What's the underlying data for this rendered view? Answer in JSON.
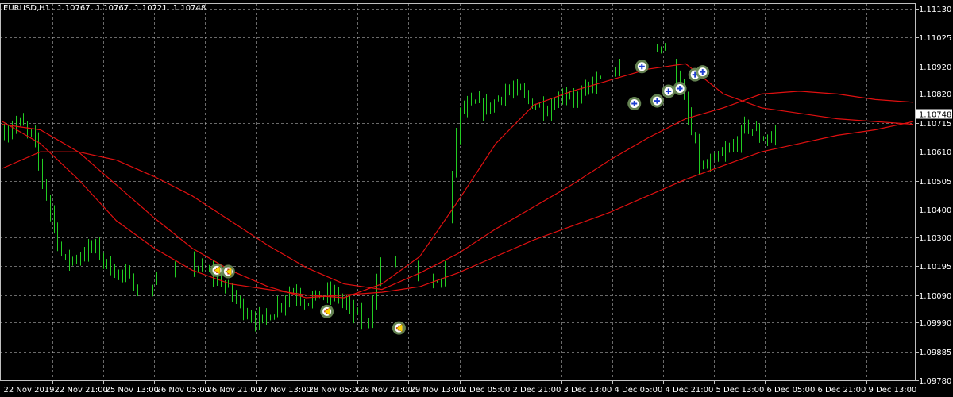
{
  "header": {
    "symbol": "EURUSD,H1",
    "open": "1.10767",
    "high": "1.10767",
    "low": "1.10721",
    "close": "1.10748"
  },
  "colors": {
    "background": "#000000",
    "grid": "#c0c0c0",
    "candles": "#22cc22",
    "ma": "#e01010",
    "current_price_line": "#9aa0a8",
    "arrow_buy": "#1f3fd0",
    "arrow_close": "#e03020",
    "circle": "#6e8f5a",
    "triangle": "#ffd400"
  },
  "current_price_label": "1.10748",
  "chart_data": {
    "type": "line",
    "title": "EURUSD,H1",
    "x_axis_type": "datetime",
    "x_ticks": [
      "22 Nov 2019",
      "22 Nov 21:00",
      "25 Nov 13:00",
      "26 Nov 05:00",
      "26 Nov 21:00",
      "27 Nov 13:00",
      "28 Nov 05:00",
      "28 Nov 21:00",
      "29 Nov 13:00",
      "2 Dec 05:00",
      "2 Dec 21:00",
      "3 Dec 13:00",
      "4 Dec 05:00",
      "4 Dec 21:00",
      "5 Dec 13:00",
      "6 Dec 05:00",
      "6 Dec 21:00",
      "9 Dec 13:00"
    ],
    "y_ticks": [
      1.1113,
      1.11025,
      1.1092,
      1.1082,
      1.10715,
      1.1061,
      1.10505,
      1.104,
      1.103,
      1.10195,
      1.1009,
      1.0999,
      1.09885,
      1.0978
    ],
    "ylim": [
      1.0978,
      1.1115
    ],
    "grid": true,
    "current_price": 1.10748,
    "close_series": {
      "name": "EURUSD close",
      "x": [
        0,
        4,
        8,
        12,
        16,
        20,
        24,
        28,
        32,
        36,
        40,
        44,
        48,
        52,
        56,
        60,
        64,
        68,
        72,
        76,
        80,
        84,
        88,
        92,
        96,
        100,
        104,
        108,
        112,
        116,
        120,
        124,
        128,
        132,
        136,
        140,
        144,
        148,
        152,
        156,
        160,
        164,
        168,
        172,
        176,
        180,
        184,
        188,
        192,
        196,
        200,
        204,
        208,
        212,
        216,
        220,
        224,
        228,
        232,
        236,
        240
      ],
      "values": [
        1.1068,
        1.1072,
        1.1066,
        1.1042,
        1.1021,
        1.1023,
        1.1027,
        1.1019,
        1.1016,
        1.1011,
        1.1013,
        1.1017,
        1.1021,
        1.1019,
        1.1016,
        1.101,
        1.1003,
        1.0999,
        1.1004,
        1.1011,
        1.1007,
        1.1009,
        1.1009,
        1.1003,
        1.0998,
        1.1023,
        1.102,
        1.1018,
        1.1012,
        1.1014,
        1.1075,
        1.1078,
        1.1077,
        1.1083,
        1.1083,
        1.1078,
        1.1077,
        1.1083,
        1.108,
        1.1087,
        1.1087,
        1.1095,
        1.1099,
        1.1101,
        1.1097,
        1.1076,
        1.1054,
        1.1058,
        1.1062,
        1.1071,
        1.1066,
        1.1067
      ]
    },
    "series": [
      {
        "name": "",
        "x": [
          0,
          10,
          20,
          30,
          40,
          50,
          60,
          70,
          80,
          90,
          100,
          110,
          120,
          130,
          140,
          150,
          160,
          170,
          180,
          190,
          200,
          210,
          220,
          230,
          240
        ],
        "values": [
          1.1072,
          1.1064,
          1.1051,
          1.1036,
          1.1026,
          1.1018,
          1.1013,
          1.1011,
          1.1009,
          1.1008,
          1.1013,
          1.1023,
          1.1043,
          1.1064,
          1.1078,
          1.1083,
          1.1087,
          1.1091,
          1.1093,
          1.1082,
          1.1077,
          1.1075,
          1.1073,
          1.1072,
          1.1071
        ]
      },
      {
        "name": "",
        "x": [
          0,
          10,
          20,
          30,
          40,
          50,
          60,
          70,
          80,
          90,
          100,
          110,
          120,
          130,
          140,
          150,
          160,
          170,
          180,
          190,
          200,
          210,
          220,
          230,
          240
        ],
        "values": [
          1.1055,
          1.1061,
          1.1061,
          1.1058,
          1.1052,
          1.1045,
          1.1036,
          1.1027,
          1.1019,
          1.1013,
          1.1011,
          1.1017,
          1.1024,
          1.1033,
          1.1041,
          1.1049,
          1.1058,
          1.1066,
          1.1073,
          1.1077,
          1.1082,
          1.1083,
          1.1082,
          1.108,
          1.1079
        ]
      },
      {
        "name": "",
        "x": [
          0,
          10,
          20,
          30,
          40,
          50,
          60,
          70,
          80,
          90,
          100,
          110,
          120,
          130,
          140,
          150,
          160,
          170,
          180,
          190,
          200,
          210,
          220,
          230,
          240
        ],
        "values": [
          1.1071,
          1.1069,
          1.1061,
          1.1049,
          1.1037,
          1.1026,
          1.1018,
          1.1012,
          1.1008,
          1.1009,
          1.101,
          1.1012,
          1.1017,
          1.1023,
          1.1029,
          1.1034,
          1.1039,
          1.1045,
          1.1051,
          1.1056,
          1.1061,
          1.1064,
          1.1067,
          1.1069,
          1.1072
        ]
      }
    ],
    "markers": [
      {
        "kind": "close",
        "x": 56.5,
        "y": 1.1018
      },
      {
        "kind": "close",
        "x": 59.5,
        "y": 1.10175
      },
      {
        "kind": "close",
        "x": 85.5,
        "y": 1.1003
      },
      {
        "kind": "close",
        "x": 104.5,
        "y": 1.0997
      },
      {
        "kind": "buy",
        "x": 166.5,
        "y": 1.10785
      },
      {
        "kind": "buy",
        "x": 168.5,
        "y": 1.1092
      },
      {
        "kind": "buy",
        "x": 172.5,
        "y": 1.10795
      },
      {
        "kind": "buy",
        "x": 175.5,
        "y": 1.1083
      },
      {
        "kind": "buy",
        "x": 178.5,
        "y": 1.1084
      },
      {
        "kind": "buy",
        "x": 182.5,
        "y": 1.1089
      },
      {
        "kind": "buy",
        "x": 184.5,
        "y": 1.109
      }
    ]
  }
}
